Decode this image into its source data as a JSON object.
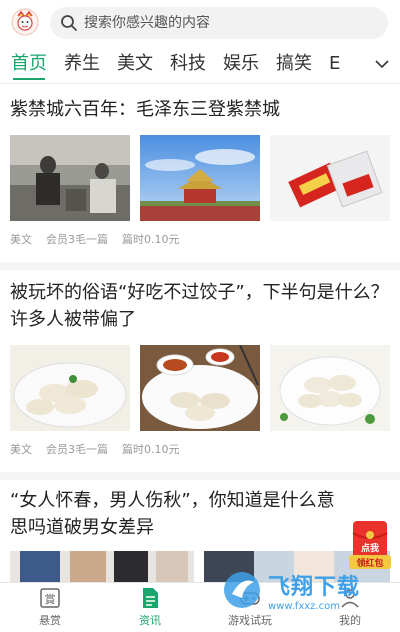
{
  "header": {
    "search_placeholder": "搜索你感兴趣的内容"
  },
  "tabs": [
    {
      "label": "首页",
      "active": true
    },
    {
      "label": "养生"
    },
    {
      "label": "美文"
    },
    {
      "label": "科技"
    },
    {
      "label": "娱乐"
    },
    {
      "label": "搞笑"
    },
    {
      "label": "E"
    }
  ],
  "articles": [
    {
      "title": "紫禁城六百年：毛泽东三登紫禁城",
      "meta": {
        "category": "美文",
        "price": "会员3毛一篇",
        "duration": "篇时0.10元"
      }
    },
    {
      "title": "被玩坏的俗语“好吃不过饺子”，下半句是什么？许多人被带偏了",
      "meta": {
        "category": "美文",
        "price": "会员3毛一篇",
        "duration": "篇时0.10元"
      }
    },
    {
      "title": "“女人怀春，男人伤秋”，你知道是什么意思吗道破男女差异"
    }
  ],
  "float": {
    "top": "点我",
    "bottom": "领红包",
    "color": "#e8322b"
  },
  "bottom_nav": [
    {
      "label": "悬赏",
      "icon": "reward-icon"
    },
    {
      "label": "资讯",
      "icon": "news-icon",
      "active": true
    },
    {
      "label": "游戏试玩",
      "icon": "game-icon"
    },
    {
      "label": "我的",
      "icon": "profile-icon"
    }
  ],
  "watermark": {
    "text": "飞翔下载",
    "url": "www.fxxz.com"
  },
  "colors": {
    "accent": "#1aa56d",
    "red": "#e8322b"
  }
}
